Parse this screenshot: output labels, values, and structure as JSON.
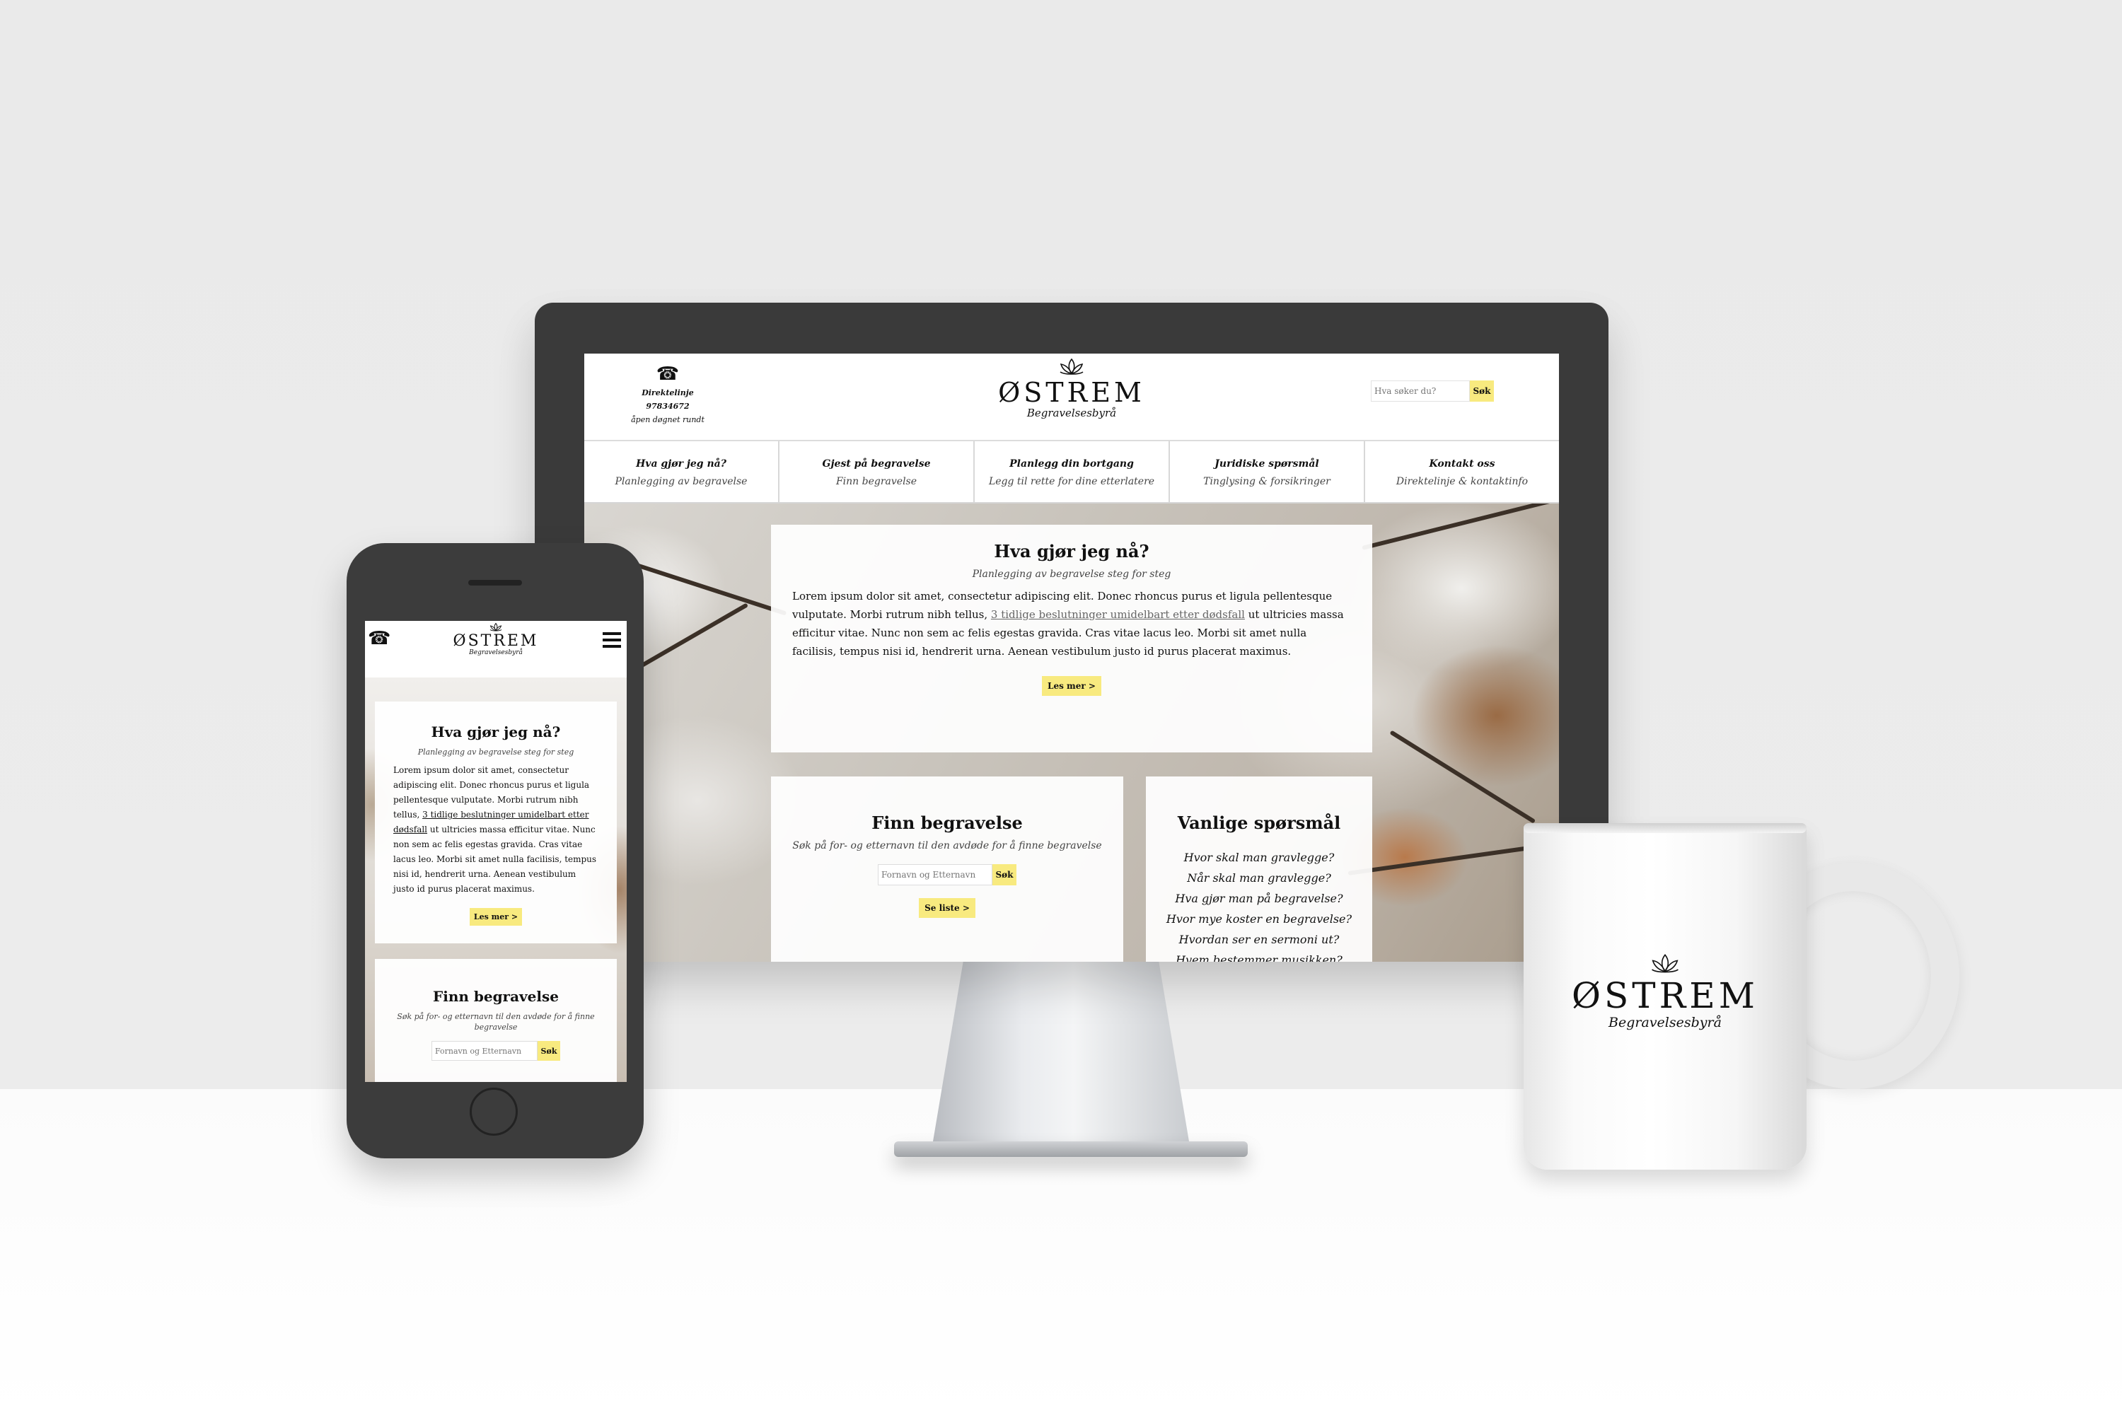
{
  "brand": {
    "name": "ØSTREM",
    "subtitle": "Begravelsesbyrå"
  },
  "header": {
    "hotline_line1": "Direktelinje 97834672",
    "hotline_line2": "åpen døgnet rundt",
    "search_placeholder": "Hva søker du?",
    "search_button": "Søk",
    "icons": [
      "telephone-icon",
      "lotus-logo-icon",
      "menu-icon"
    ]
  },
  "nav": [
    {
      "title": "Hva gjør jeg nå?",
      "sub": "Planlegging av begravelse"
    },
    {
      "title": "Gjest på begravelse",
      "sub": "Finn begravelse"
    },
    {
      "title": "Planlegg din bortgang",
      "sub": "Legg til rette for dine etterlatere"
    },
    {
      "title": "Juridiske spørsmål",
      "sub": "Tinglysing & forsikringer"
    },
    {
      "title": "Kontakt oss",
      "sub": "Direktelinje & kontaktinfo"
    }
  ],
  "intro": {
    "title": "Hva gjør jeg nå?",
    "subtitle": "Planlegging av begravelse steg for steg",
    "text_before": "Lorem ipsum dolor sit amet, consectetur adipiscing elit. Donec rhoncus purus et ligula pellentesque vulputate. Morbi rutrum nibh tellus, ",
    "link": "3 tidlige beslutninger umidelbart etter dødsfall",
    "text_after": " ut ultricies massa efficitur vitae. Nunc non sem ac felis egestas gravida. Cras vitae lacus leo. Morbi sit amet nulla facilisis, tempus nisi id, hendrerit urna. Aenean vestibulum justo id purus placerat maximus.",
    "button": "Les mer >"
  },
  "find": {
    "title": "Finn begravelse",
    "subtitle": "Søk på for- og etternavn til den avdøde for å finne begravelse",
    "input_placeholder": "Fornavn og Etternavn",
    "button": "Søk",
    "list_button": "Se liste >"
  },
  "faq": {
    "title": "Vanlige spørsmål",
    "items": [
      "Hvor skal man gravlegge?",
      "Når skal man gravlegge?",
      "Hva gjør man på begravelse?",
      "Hvor mye koster en begravelse?",
      "Hvordan ser en sermoni ut?",
      "Hvem bestemmer musikken?"
    ]
  }
}
